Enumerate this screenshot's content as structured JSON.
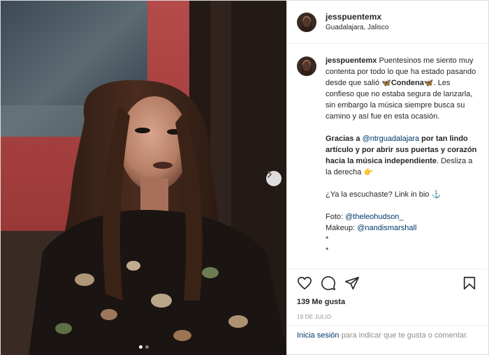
{
  "post": {
    "username": "jesspuentemx",
    "location": "Guadalajara, Jalisco",
    "caption": {
      "author": "jesspuentemx",
      "p1_before": "Puentesinos me siento muy contenta por todo lo que ha estado pasando desde que salió ",
      "song_emoji": "🦋",
      "song": "Condena",
      "p1_after": ". Les confieso que no estaba segura de lanzarla, sin embargo la música siempre busca su camino y así fue en esta ocasión.",
      "p2_start": "Gracias a ",
      "mention1": "@ntrguadalajara",
      "p2_bold": " por tan lindo artículo y por abrir sus puertas y corazón hacia la música independiente",
      "p2_end": ". Desliza a la derecha ",
      "point_emoji": "👉",
      "p3": "¿Ya la escuchaste? Link in bio ",
      "anchor_emoji": "⚓",
      "photo_label": "Foto: ",
      "photo_credit": "@theleohudson_",
      "makeup_label": "Makeup: ",
      "makeup_credit": "@nandismarshall",
      "dot1": "*",
      "dot2": "*"
    },
    "likes": "139 Me gusta",
    "date": "19 DE JULIO",
    "login_link": "Inicia sesión",
    "login_text": " para indicar que te gusta o comentar."
  },
  "icons": {
    "like": "heart-icon",
    "comment": "comment-icon",
    "share": "share-icon",
    "save": "bookmark-icon",
    "next": "chevron-right-icon"
  },
  "carousel": {
    "total": 2,
    "active": 1
  },
  "colors": {
    "link": "#00376b",
    "muted": "#8e8e8e",
    "text": "#262626",
    "wall": "#c65a5a"
  }
}
